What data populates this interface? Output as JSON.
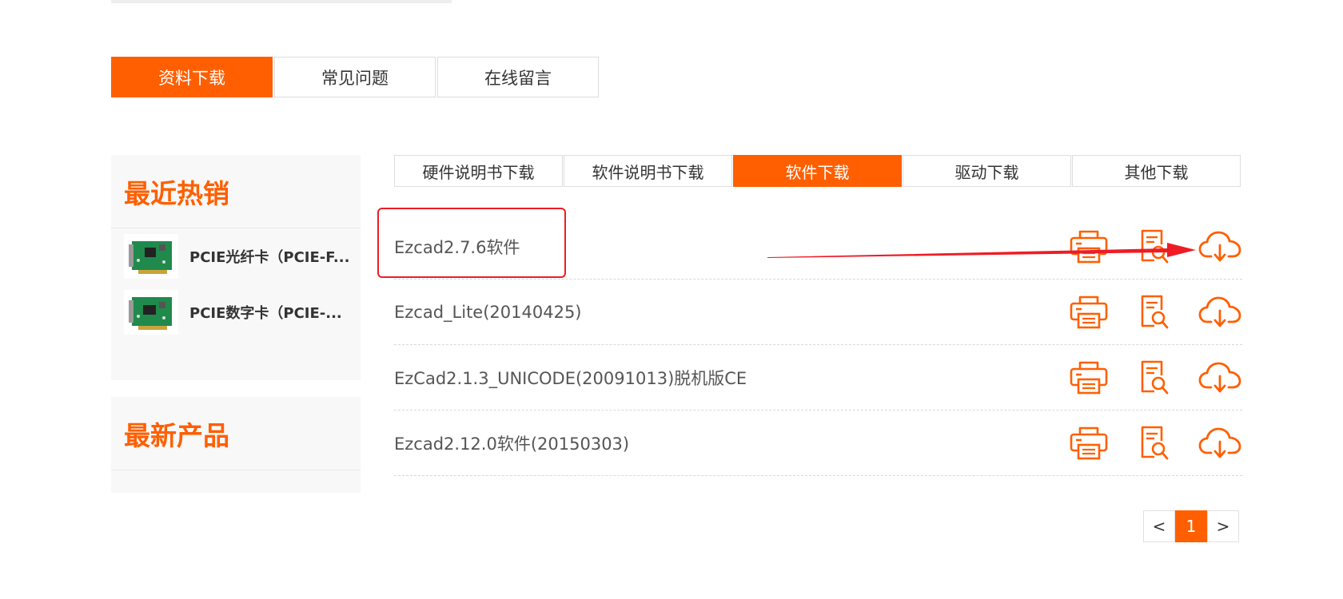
{
  "main_tabs": [
    {
      "label": "资料下载",
      "active": true
    },
    {
      "label": "常见问题",
      "active": false
    },
    {
      "label": "在线留言",
      "active": false
    }
  ],
  "sidebar": {
    "hot_title": "最近热销",
    "hot_items": [
      {
        "name": "PCIE光纤卡（PCIE-F..."
      },
      {
        "name": "PCIE数字卡（PCIE-..."
      }
    ],
    "new_title": "最新产品"
  },
  "sub_tabs": [
    {
      "label": "硬件说明书下载",
      "active": false
    },
    {
      "label": "软件说明书下载",
      "active": false
    },
    {
      "label": "软件下载",
      "active": true
    },
    {
      "label": "驱动下载",
      "active": false
    },
    {
      "label": "其他下载",
      "active": false
    }
  ],
  "files": [
    {
      "name": "Ezcad2.7.6软件"
    },
    {
      "name": "Ezcad_Lite(20140425)"
    },
    {
      "name": "EzCad2.1.3_UNICODE(20091013)脱机版CE"
    },
    {
      "name": "Ezcad2.12.0软件(20150303)"
    }
  ],
  "row_action_icons": [
    "printer-icon",
    "document-search-icon",
    "cloud-download-icon"
  ],
  "pagination": {
    "prev": "<",
    "current": "1",
    "next": ">"
  },
  "colors": {
    "accent": "#ff5f00",
    "annotation": "#ee1c25"
  }
}
